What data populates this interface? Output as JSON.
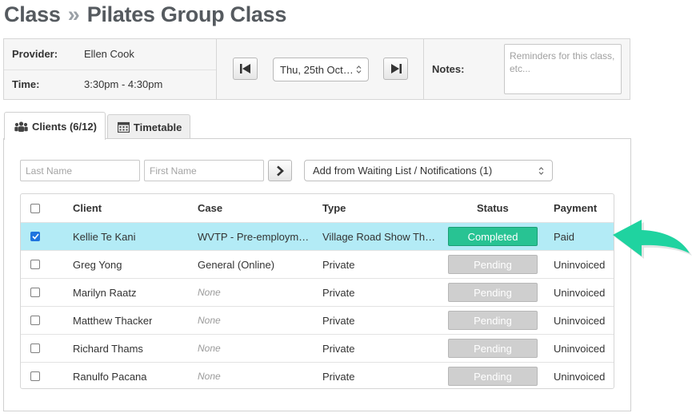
{
  "page": {
    "title_prefix": "Class",
    "title_sep": "»",
    "title_main": "Pilates Group Class"
  },
  "info": {
    "provider_label": "Provider:",
    "provider_value": "Ellen Cook",
    "time_label": "Time:",
    "time_value": "3:30pm - 4:30pm",
    "date_value": "Thu, 25th Oct…",
    "notes_label": "Notes:",
    "notes_placeholder": "Reminders for this class, etc..."
  },
  "tabs": [
    {
      "label": "Clients (6/12)",
      "icon": "users-icon",
      "active": true
    },
    {
      "label": "Timetable",
      "icon": "calendar-icon",
      "active": false
    }
  ],
  "filters": {
    "last_name_placeholder": "Last Name",
    "first_name_placeholder": "First Name",
    "waiting_list_label": "Add from Waiting List / Notifications (1)"
  },
  "table": {
    "headers": {
      "client": "Client",
      "case": "Case",
      "type": "Type",
      "status": "Status",
      "payment": "Payment"
    },
    "rows": [
      {
        "client": "Kellie Te Kani",
        "case": "WVTP - Pre-employm…",
        "type": "Village Road Show Th…",
        "status": "Completed",
        "payment": "Paid",
        "checked": true
      },
      {
        "client": "Greg Yong",
        "case": "General (Online)",
        "type": "Private",
        "status": "Pending",
        "payment": "Uninvoiced",
        "checked": false
      },
      {
        "client": "Marilyn Raatz",
        "case": "None",
        "type": "Private",
        "status": "Pending",
        "payment": "Uninvoiced",
        "checked": false
      },
      {
        "client": "Matthew Thacker",
        "case": "None",
        "type": "Private",
        "status": "Pending",
        "payment": "Uninvoiced",
        "checked": false
      },
      {
        "client": "Richard Thams",
        "case": "None",
        "type": "Private",
        "status": "Pending",
        "payment": "Uninvoiced",
        "checked": false
      },
      {
        "client": "Ranulfo Pacana",
        "case": "None",
        "type": "Private",
        "status": "Pending",
        "payment": "Uninvoiced",
        "checked": false
      }
    ]
  },
  "colors": {
    "completed": "#28c393",
    "pending": "#cfcfcf",
    "selected_row": "#b3ebf6",
    "arrow": "#1fd3a0"
  }
}
